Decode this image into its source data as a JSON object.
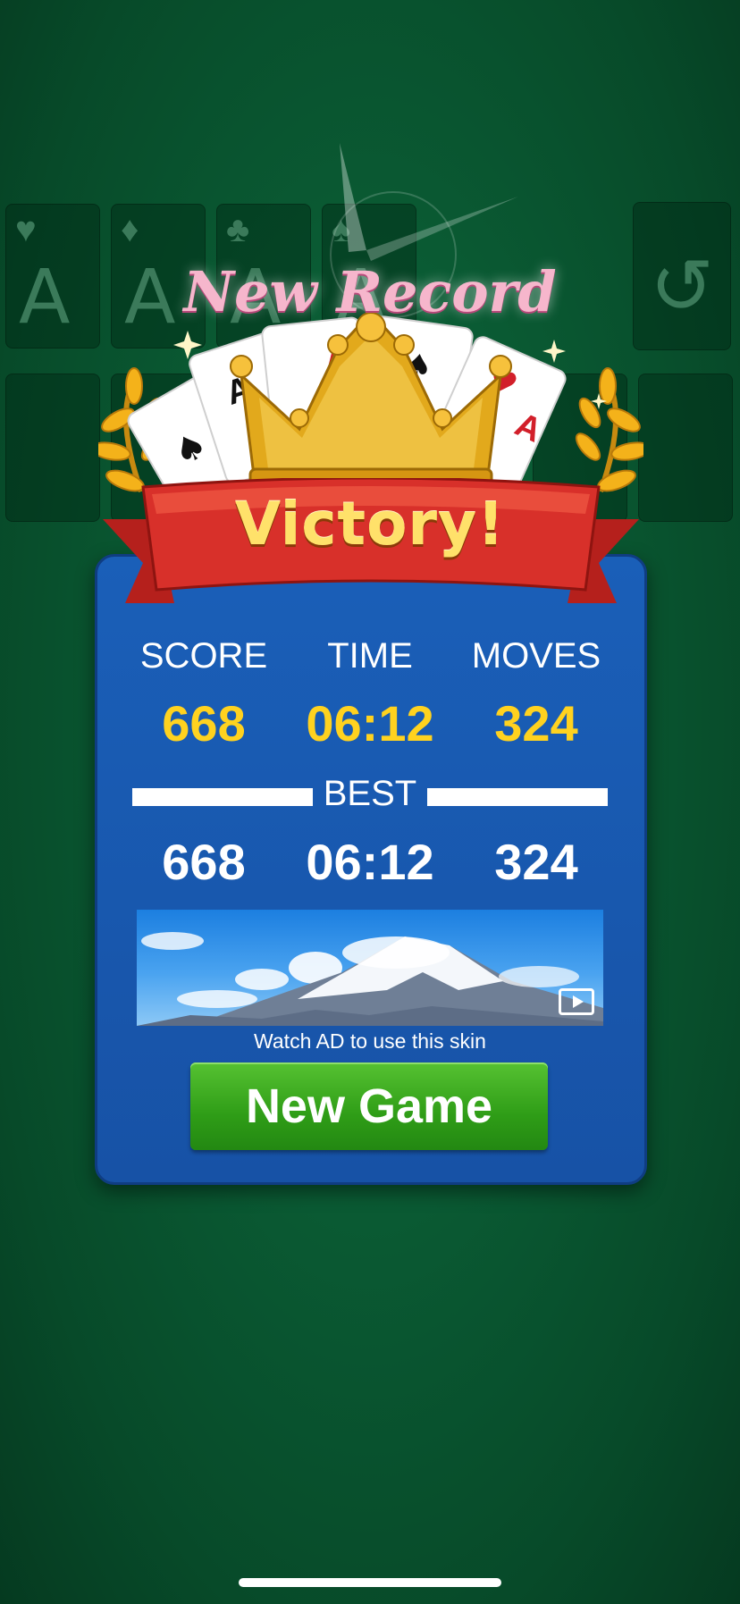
{
  "foundation": [
    {
      "suit_icon": "heart-icon",
      "suit_glyph": "♥",
      "rank": "A"
    },
    {
      "suit_icon": "diamond-icon",
      "suit_glyph": "♦",
      "rank": "A"
    },
    {
      "suit_icon": "club-icon",
      "suit_glyph": "♣",
      "rank": "A"
    },
    {
      "suit_icon": "spade-icon",
      "suit_glyph": "♠",
      "rank": "A"
    }
  ],
  "undo_icon": "undo-icon",
  "new_record": "New Record",
  "victory": "Victory!",
  "card_ranks": {
    "c1": "A",
    "c2": "A",
    "c3": "A",
    "c4": "A",
    "c5": "A"
  },
  "stats": {
    "score_label": "SCORE",
    "time_label": "TIME",
    "moves_label": "MOVES",
    "score": "668",
    "time": "06:12",
    "moves": "324"
  },
  "best": {
    "label": "BEST",
    "score": "668",
    "time": "06:12",
    "moves": "324"
  },
  "ad": {
    "caption": "Watch AD to use this skin",
    "play_icon": "video-play-icon"
  },
  "new_game_label": "New Game",
  "colors": {
    "felt": "#0a5a33",
    "panel": "#1a5fb8",
    "stat_value": "#ffd21f",
    "button": "#2f9d17",
    "ribbon": "#d8302a"
  }
}
